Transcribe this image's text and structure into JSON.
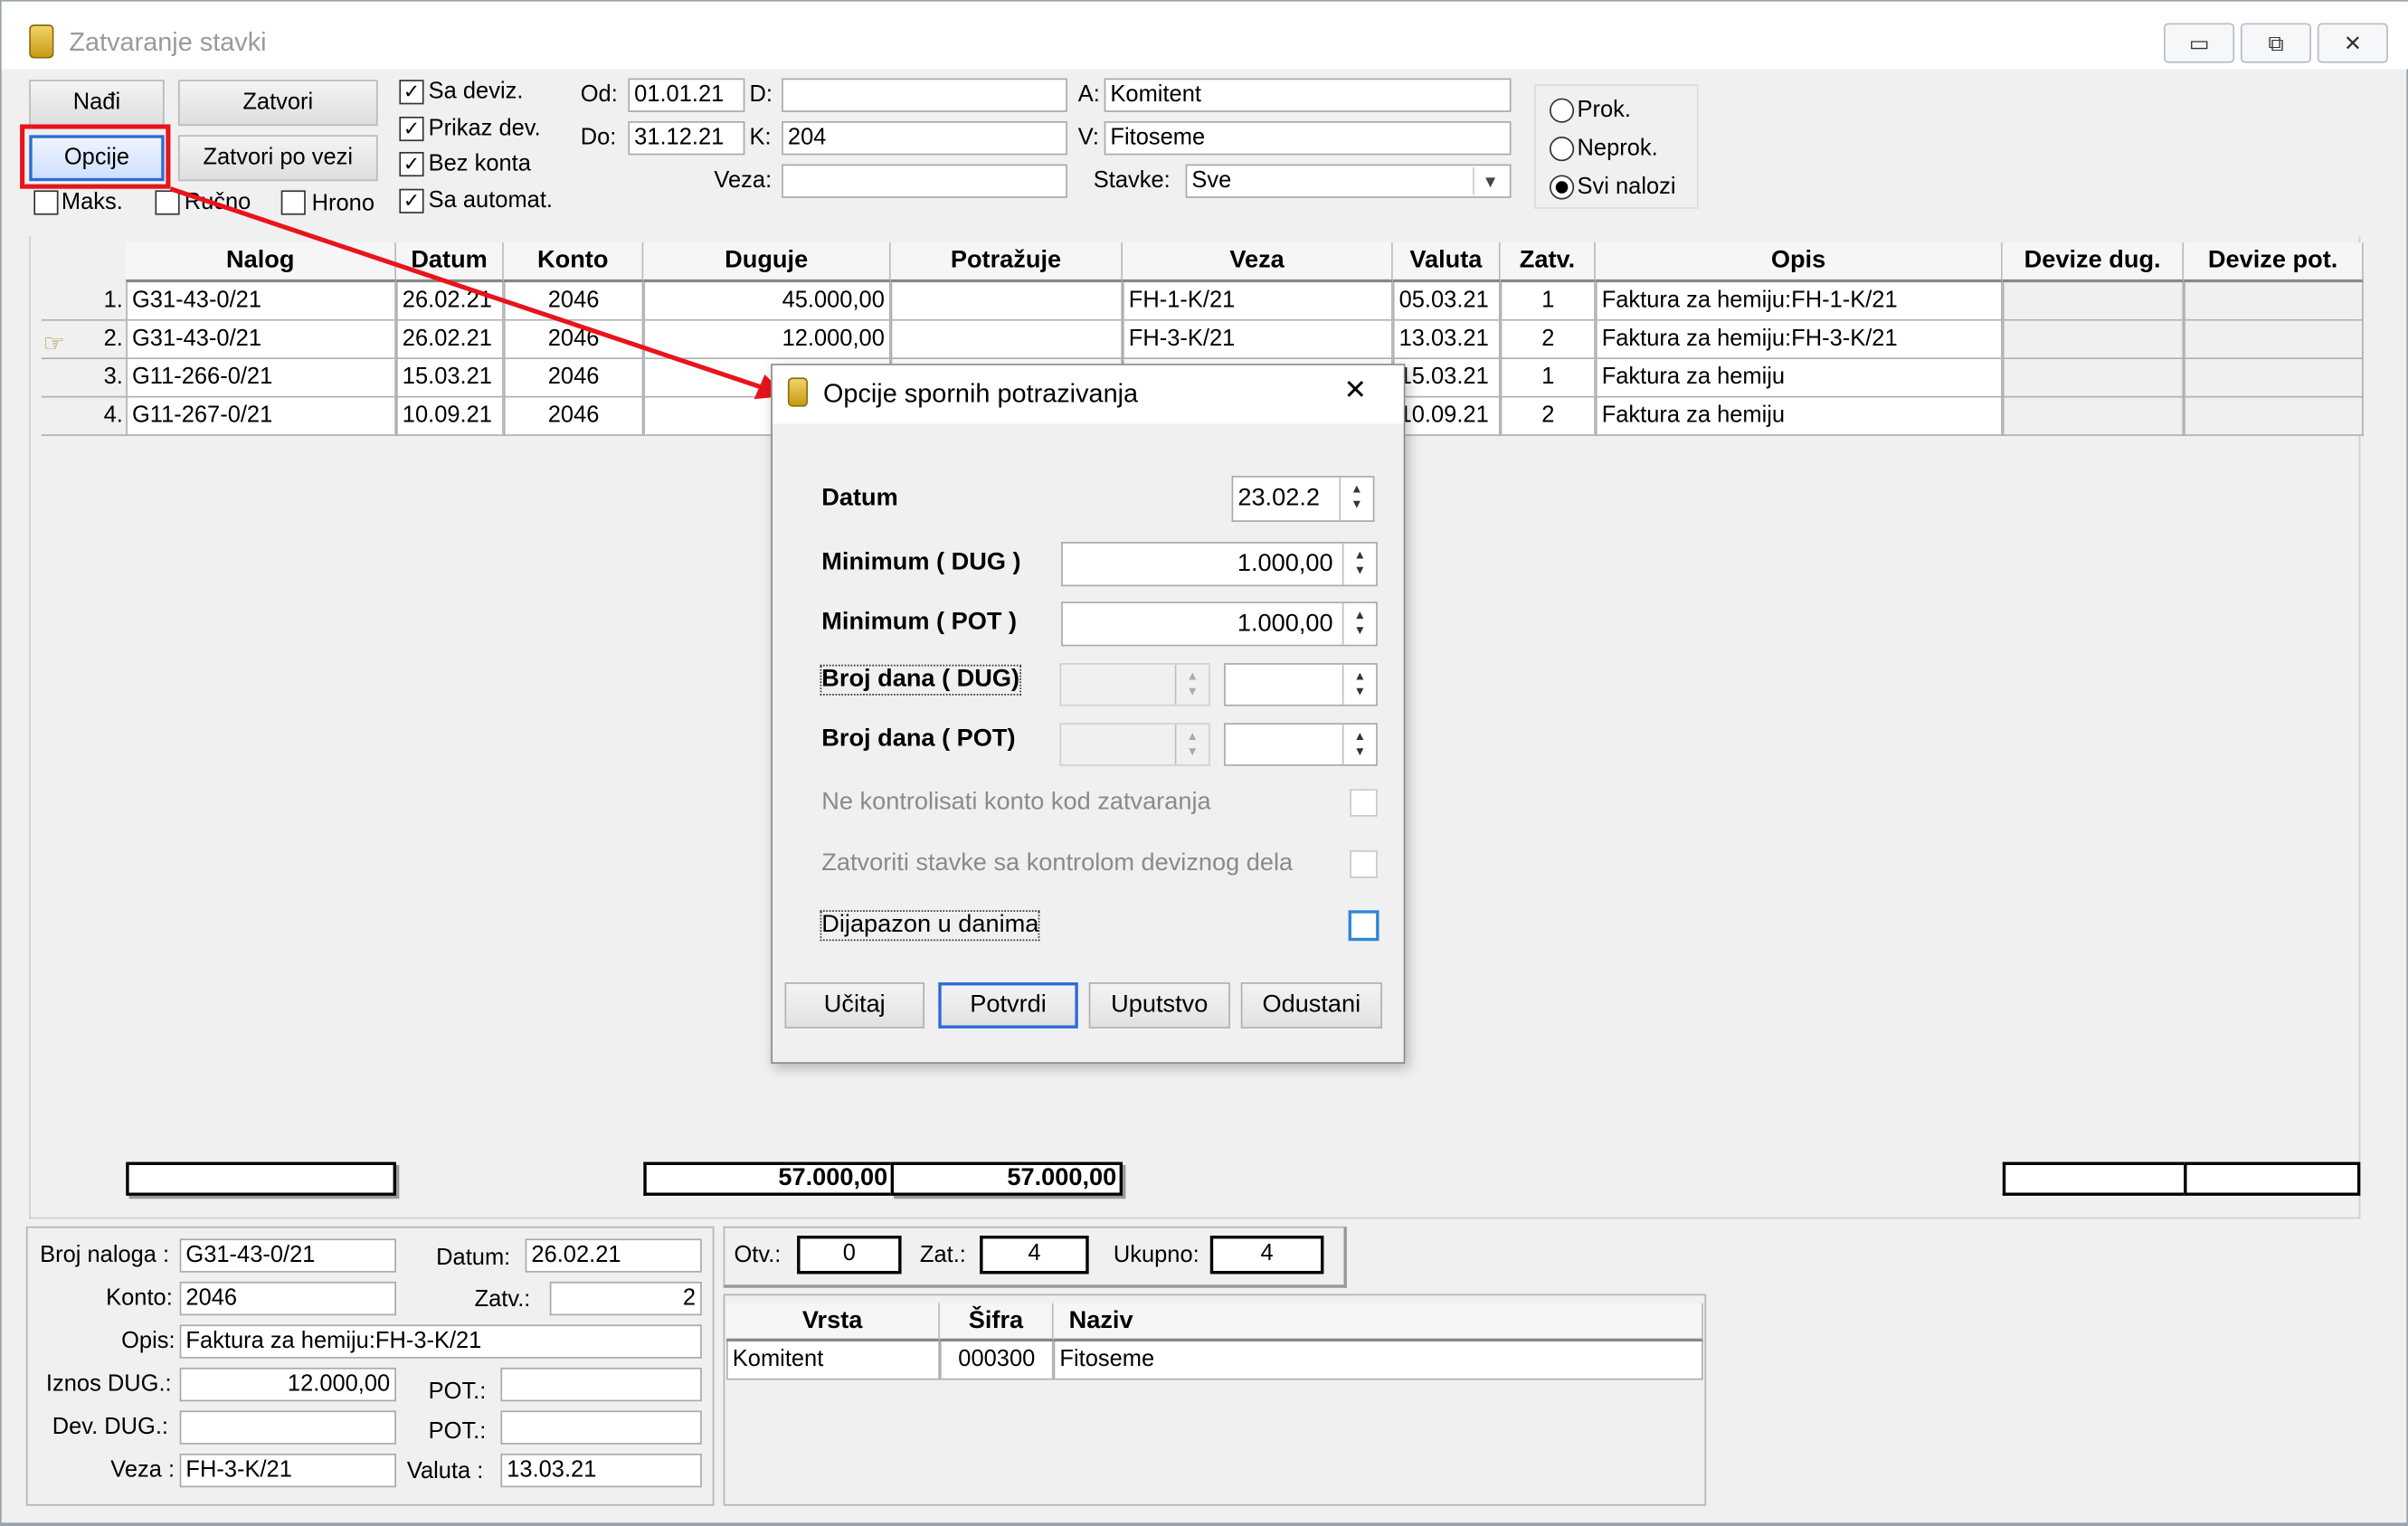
{
  "window": {
    "title": "Zatvaranje stavki",
    "minimize_glyph": "▭",
    "restore_glyph": "⧉",
    "close_glyph": "✕"
  },
  "toolbar": {
    "find": "Nađi",
    "close": "Zatvori",
    "options": "Opcije",
    "close_by_link": "Zatvori po vezi",
    "maks": "Maks.",
    "rucno": "Ručno",
    "hrono": "Hrono"
  },
  "checks": {
    "sa_deviz": {
      "label": "Sa deviz.",
      "checked": true
    },
    "prikaz_dev": {
      "label": "Prikaz dev.",
      "checked": true
    },
    "bez_konta": {
      "label": "Bez konta",
      "checked": true
    },
    "sa_automat": {
      "label": "Sa automat.",
      "checked": true
    }
  },
  "filters": {
    "od_label": "Od:",
    "od_value": "01.01.21",
    "do_label": "Do:",
    "do_value": "31.12.21",
    "d_label": "D:",
    "d_value": "",
    "k_label": "K:",
    "k_value": "204",
    "veza_label": "Veza:",
    "veza_value": "",
    "a_label": "A:",
    "a_value": "Komitent",
    "v_label": "V:",
    "v_value": "Fitoseme",
    "stavke_label": "Stavke:",
    "stavke_value": "Sve"
  },
  "radios": {
    "prok": "Prok.",
    "neprok": "Neprok.",
    "svi": "Svi nalozi",
    "selected": "svi"
  },
  "grid": {
    "headers": [
      "Nalog",
      "Datum",
      "Konto",
      "Duguje",
      "Potražuje",
      "Veza",
      "Valuta",
      "Zatv.",
      "Opis",
      "Devize dug.",
      "Devize pot."
    ],
    "rows": [
      {
        "num": "1.",
        "nalog": "G31-43-0/21",
        "datum": "26.02.21",
        "konto": "2046",
        "duguje": "45.000,00",
        "potrazuje": "",
        "veza": "FH-1-K/21",
        "valuta": "05.03.21",
        "zatv": "1",
        "opis": "Faktura za hemiju:FH-1-K/21",
        "dev_dug": "",
        "dev_pot": ""
      },
      {
        "num": "2.",
        "nalog": "G31-43-0/21",
        "datum": "26.02.21",
        "konto": "2046",
        "duguje": "12.000,00",
        "potrazuje": "",
        "veza": "FH-3-K/21",
        "valuta": "13.03.21",
        "zatv": "2",
        "opis": "Faktura za hemiju:FH-3-K/21",
        "dev_dug": "",
        "dev_pot": ""
      },
      {
        "num": "3.",
        "nalog": "G11-266-0/21",
        "datum": "15.03.21",
        "konto": "2046",
        "duguje": "",
        "potrazuje": "",
        "veza": "",
        "valuta": "15.03.21",
        "zatv": "1",
        "opis": "Faktura za hemiju",
        "dev_dug": "",
        "dev_pot": ""
      },
      {
        "num": "4.",
        "nalog": "G11-267-0/21",
        "datum": "10.09.21",
        "konto": "2046",
        "duguje": "",
        "potrazuje": "",
        "veza": "",
        "valuta": "10.09.21",
        "zatv": "2",
        "opis": "Faktura za hemiju",
        "dev_dug": "",
        "dev_pot": ""
      }
    ],
    "totals": {
      "duguje": "57.000,00",
      "potrazuje": "57.000,00"
    }
  },
  "detail": {
    "broj_naloga_label": "Broj naloga :",
    "broj_naloga": "G31-43-0/21",
    "datum_label": "Datum:",
    "datum": "26.02.21",
    "konto_label": "Konto:",
    "konto": "2046",
    "zatv_label": "Zatv.:",
    "zatv": "2",
    "opis_label": "Opis:",
    "opis": "Faktura za hemiju:FH-3-K/21",
    "iznos_dug_label": "Iznos DUG.:",
    "iznos_dug": "12.000,00",
    "pot_label": "POT.:",
    "pot": "",
    "dev_dug_label": "Dev. DUG.:",
    "dev_dug": "",
    "dev_pot_label": "POT.:",
    "dev_pot": "",
    "veza_label": "Veza :",
    "veza": "FH-3-K/21",
    "valuta_label": "Valuta :",
    "valuta": "13.03.21"
  },
  "counts": {
    "otv_label": "Otv.:",
    "otv": "0",
    "zat_label": "Zat.:",
    "zat": "4",
    "ukupno_label": "Ukupno:",
    "ukupno": "4"
  },
  "analytics": {
    "headers": [
      "Vrsta",
      "Šifra",
      "Naziv"
    ],
    "rows": [
      {
        "vrsta": "Komitent",
        "sifra": "000300",
        "naziv": "Fitoseme"
      }
    ]
  },
  "dialog": {
    "title": "Opcije spornih potrazivanja",
    "close_glyph": "✕",
    "datum_label": "Datum",
    "datum_value": "23.02.2",
    "min_dug_label": "Minimum ( DUG )",
    "min_dug_value": "1.000,00",
    "min_pot_label": "Minimum ( POT )",
    "min_pot_value": "1.000,00",
    "broj_dana_dug_label": "Broj dana ( DUG)",
    "broj_dana_pot_label": "Broj dana ( POT)",
    "ne_kontrolisati": "Ne kontrolisati konto kod zatvaranja",
    "zatvoriti_stavke": "Zatvoriti stavke sa kontrolom deviznog dela",
    "dijapazon": "Dijapazon u danima",
    "btn_ucitaj": "Učitaj",
    "btn_potvrdi": "Potvrdi",
    "btn_uputstvo": "Uputstvo",
    "btn_odustani": "Odustani"
  },
  "colors": {
    "annotation_red": "#e8141c",
    "focus_blue": "#2f6bd6"
  }
}
